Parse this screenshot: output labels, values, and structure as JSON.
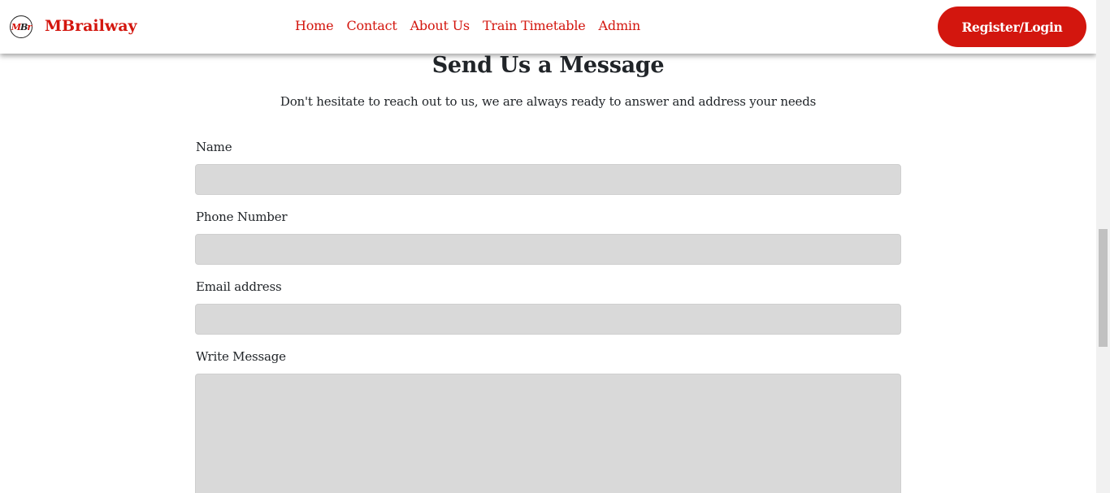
{
  "nav": {
    "brand": "MBrailway",
    "logo_text": {
      "m": "M",
      "b": "B",
      "r": "r"
    },
    "links": [
      "Home",
      "Contact",
      "About Us",
      "Train Timetable",
      "Admin"
    ],
    "register_label": "Register/Login"
  },
  "main": {
    "title": "Send Us a Message",
    "subtitle": "Don't hesitate to reach out to us, we are always ready to answer and address your needs",
    "fields": {
      "name_label": "Name",
      "name_value": "",
      "phone_label": "Phone Number",
      "phone_value": "",
      "email_label": "Email address",
      "email_value": "",
      "message_label": "Write Message",
      "message_value": ""
    }
  },
  "colors": {
    "accent": "#d3160e",
    "input_bg": "#d9d9d9",
    "text": "#212529"
  },
  "icons": {
    "logo": "mbr-logo-icon"
  }
}
